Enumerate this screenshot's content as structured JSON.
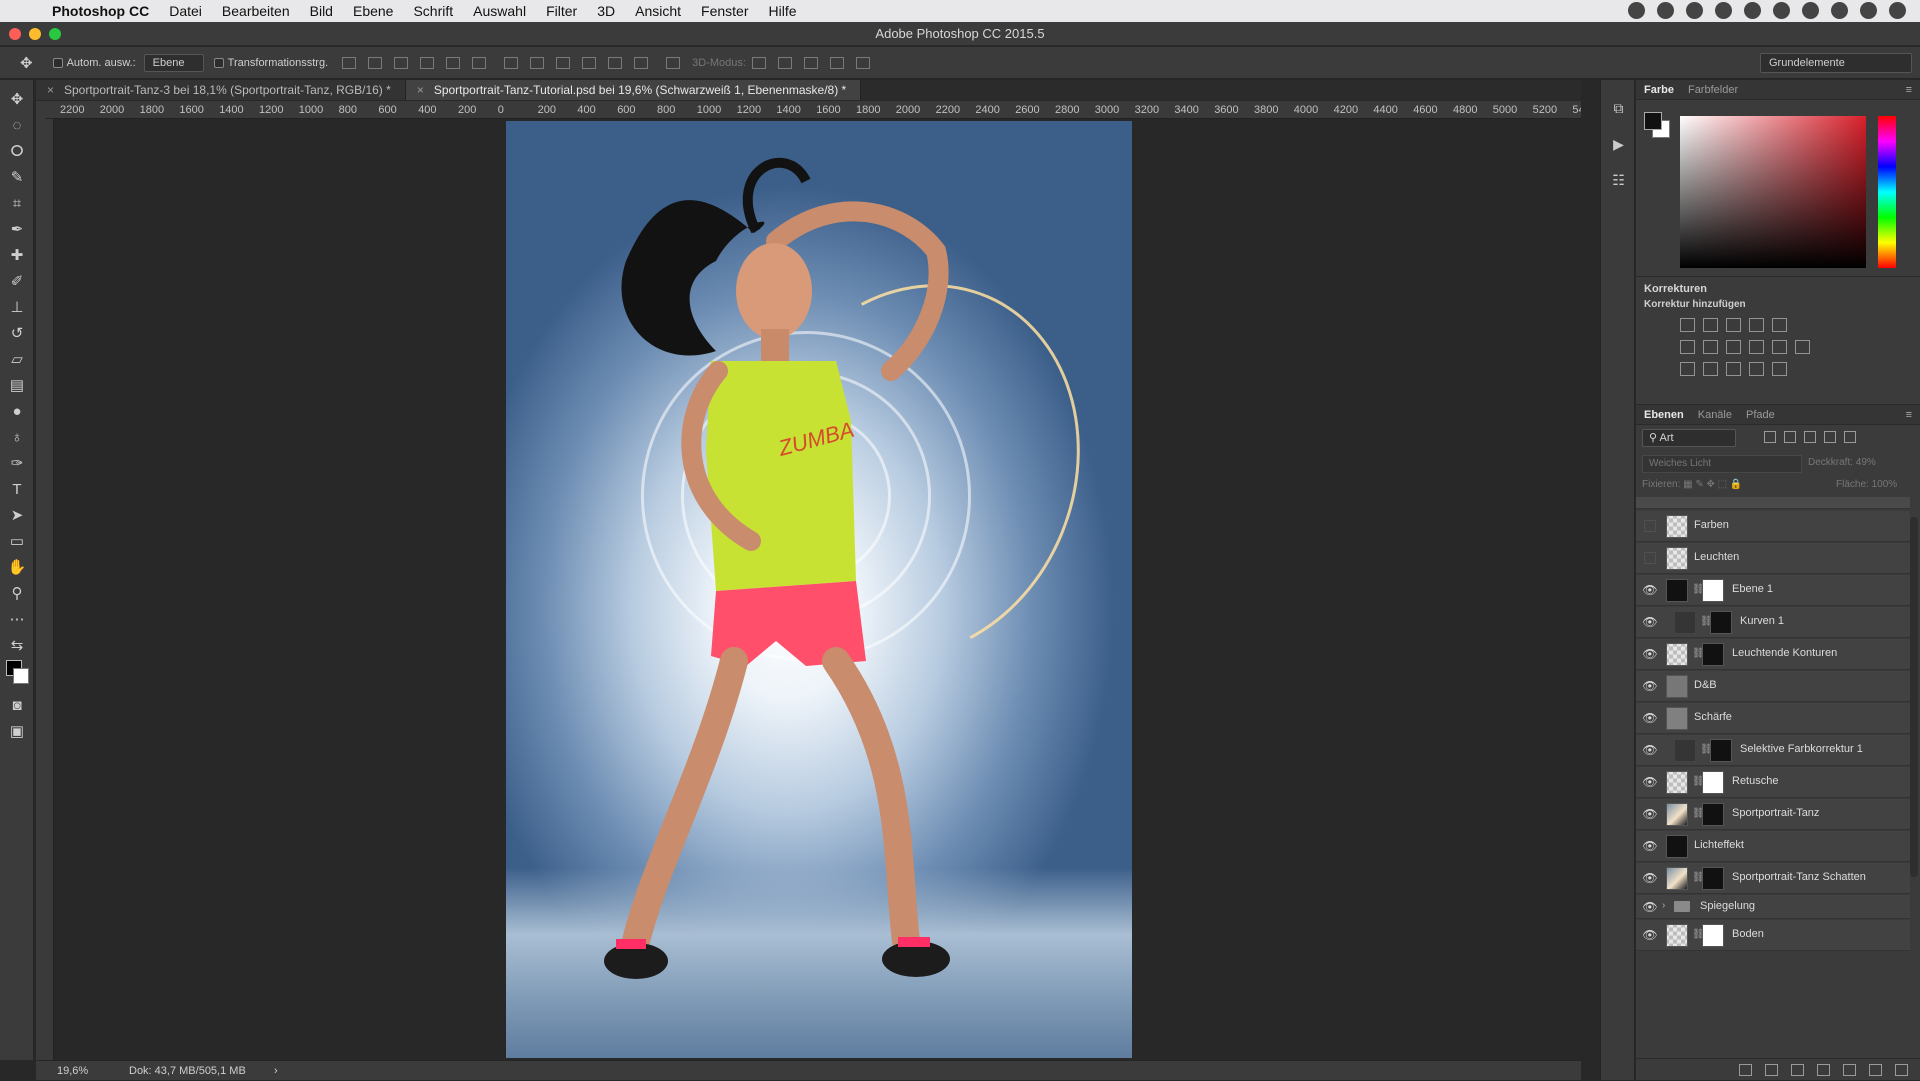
{
  "menubar": {
    "app": "Photoshop CC",
    "items": [
      "Datei",
      "Bearbeiten",
      "Bild",
      "Ebene",
      "Schrift",
      "Auswahl",
      "Filter",
      "3D",
      "Ansicht",
      "Fenster",
      "Hilfe"
    ]
  },
  "window": {
    "title": "Adobe Photoshop CC 2015.5"
  },
  "options": {
    "auto_select_label": "Autom. ausw.:",
    "auto_select_value": "Ebene",
    "transform_label": "Transformationsstrg.",
    "mode_label": "3D-Modus:",
    "workspace": "Grundelemente"
  },
  "tabs": [
    {
      "label": "Sportportrait-Tanz-3 bei 18,1% (Sportportrait-Tanz, RGB/16) *"
    },
    {
      "label": "Sportportrait-Tanz-Tutorial.psd bei 19,6% (Schwarzweiß 1, Ebenenmaske/8) *"
    }
  ],
  "ruler": {
    "ticks": [
      "2200",
      "2000",
      "1800",
      "1600",
      "1400",
      "1200",
      "1000",
      "800",
      "600",
      "400",
      "200",
      "0",
      "200",
      "400",
      "600",
      "800",
      "1000",
      "1200",
      "1400",
      "1600",
      "1800",
      "2000",
      "2200",
      "2400",
      "2600",
      "2800",
      "3000",
      "3200",
      "3400",
      "3600",
      "3800",
      "4000",
      "4200",
      "4400",
      "4600",
      "4800",
      "5000",
      "5200",
      "54"
    ]
  },
  "status": {
    "zoom": "19,6%",
    "doc": "Dok: 43,7 MB/505,1 MB"
  },
  "color_panel": {
    "tabs": [
      "Farbe",
      "Farbfelder"
    ]
  },
  "corrections": {
    "title": "Korrekturen",
    "subtitle": "Korrektur hinzufügen"
  },
  "layers_panel": {
    "tabs": [
      "Ebenen",
      "Kanäle",
      "Pfade"
    ],
    "filter": "Art",
    "blend_mode": "Weiches Licht",
    "opacity_label": "Deckkraft:",
    "opacity_value": "49%",
    "lock_label": "Fixieren:",
    "fill_label": "Fläche:",
    "fill_value": "100%",
    "layers": [
      {
        "name": "Farben",
        "visible": false
      },
      {
        "name": "Leuchten",
        "visible": false
      },
      {
        "name": "Ebene 1",
        "visible": true
      },
      {
        "name": "Kurven 1",
        "visible": true
      },
      {
        "name": "Leuchtende Konturen",
        "visible": true
      },
      {
        "name": "D&B",
        "visible": true
      },
      {
        "name": "Schärfe",
        "visible": true
      },
      {
        "name": "Selektive Farbkorrektur 1",
        "visible": true
      },
      {
        "name": "Retusche",
        "visible": true
      },
      {
        "name": "Sportportrait-Tanz",
        "visible": true
      },
      {
        "name": "Lichteffekt",
        "visible": true
      },
      {
        "name": "Sportportrait-Tanz Schatten",
        "visible": true
      },
      {
        "name": "Spiegelung",
        "visible": true
      },
      {
        "name": "Boden",
        "visible": true
      }
    ]
  },
  "colors": {
    "foreground": "#000000",
    "background": "#ffffff",
    "picker_hue": "#d9202b"
  }
}
